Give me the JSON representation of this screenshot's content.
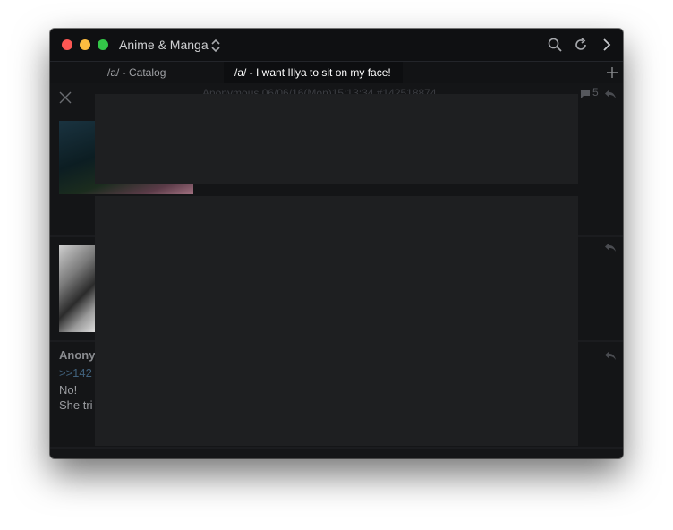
{
  "window": {
    "board_title": "Anime & Manga",
    "icons": [
      "updown-chevron-icon",
      "search-icon",
      "refresh-icon",
      "forward-icon"
    ]
  },
  "tabs": [
    {
      "label": "/a/ - Catalog",
      "active": false
    },
    {
      "label": "/a/ - I want Illya to sit on my face!",
      "active": true
    }
  ],
  "thread": {
    "header": "Anonymous 06/06/16(Mon)15:13:34 #142518874",
    "reply_count": "5",
    "post3": {
      "author": "Anony",
      "quote": ">>142",
      "lines": [
        "No!",
        "She tri"
      ]
    }
  },
  "colors": {
    "background": "#141517",
    "titlebar": "#0f1012",
    "overlay": "#1e1f21",
    "quote_link": "#40617c",
    "close": "#fc5753",
    "minimize": "#fdbc40",
    "zoom": "#33c748"
  }
}
